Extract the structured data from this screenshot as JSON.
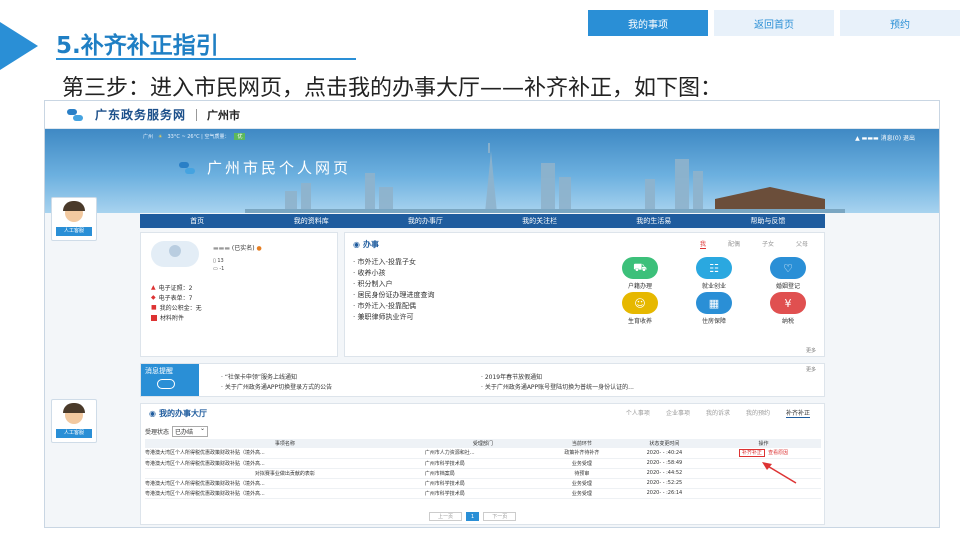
{
  "slide": {
    "section_title": "5.补齐补正指引",
    "step_text": "第三步：进入市民网页，点击我的办事大厅——补齐补正，如下图：",
    "top_tabs": [
      "我的事项",
      "返回首页",
      "预约"
    ],
    "accent_color": "#2a8fd6"
  },
  "site": {
    "portal_name": "广东政务服务网",
    "city": "广州市",
    "banner_city": "广州",
    "weather": "33°C ~ 26°C | 空气质量：",
    "aqi": "优",
    "banner_title": "广州市民个人网页",
    "user_links": "消息(0)  退出",
    "service_label": "人工客服"
  },
  "nav": [
    "首页",
    "我的资料库",
    "我的办事厅",
    "我的关注栏",
    "我的生活易",
    "帮助与反馈"
  ],
  "user_card": {
    "name": "(已实名)",
    "phone": "13",
    "line2": "-1",
    "stats": [
      "电子证照：2",
      "电子表单：7",
      "我的公积金：无",
      "材料附件"
    ]
  },
  "office": {
    "title": "办事",
    "tabs": [
      "我",
      "配偶",
      "子女",
      "父母"
    ],
    "items": [
      "市外迁入-投靠子女",
      "收养小孩",
      "积分制入户",
      "居民身份证办理进度查询",
      "市外迁入-投靠配偶",
      "兼职律师执业许可"
    ],
    "services": [
      {
        "label": "户籍办理",
        "icon": "car-icon",
        "color": "#3cc07a"
      },
      {
        "label": "就业创业",
        "icon": "people-icon",
        "color": "#2aa8e0"
      },
      {
        "label": "婚姻登记",
        "icon": "heart-icon",
        "color": "#2a8fd6"
      },
      {
        "label": "生育收养",
        "icon": "baby-icon",
        "color": "#e6b800"
      },
      {
        "label": "住房保障",
        "icon": "house-icon",
        "color": "#2a8fd6"
      },
      {
        "label": "纳税",
        "icon": "tax-icon",
        "color": "#e05050"
      }
    ],
    "more": "更多"
  },
  "messages": {
    "label": "消息提醒",
    "items": [
      "“社保卡申领”服务上线通知",
      "2019年春节放假通知",
      "关于广州政务通APP切换登录方式的公告",
      "关于广州政务通APP账号登陆切换为普统一身份认证的..."
    ],
    "more": "更多"
  },
  "hall": {
    "title": "我的办事大厅",
    "tabs": [
      "个人事项",
      "企业事项",
      "我的诉求",
      "我的预约",
      "补齐补正"
    ],
    "filter_label": "受理状态",
    "filter_value": "已办结",
    "columns": [
      "事项名称",
      "受理部门",
      "当前环节",
      "状态变更时间",
      "操作"
    ],
    "rows": [
      [
        "粤港澳大湾区个人所得税优惠政策财政补贴（境外高...",
        "广州市人力资源和社...",
        "政策补齐待补齐",
        "2020-  -  :40:24",
        "补齐补正",
        "查看原因"
      ],
      [
        "粤港澳大湾区个人所得税优惠政策财政补贴（境外高...",
        "广州市科学技术局",
        "业务受理",
        "2020-  -  :58:49",
        "",
        ""
      ],
      [
        "对拟赛事业做出贡献的表彰",
        "广州市档案局",
        "待预审",
        "2020-  -  :44:52",
        "",
        ""
      ],
      [
        "粤港澳大湾区个人所得税优惠政策财政补贴（境外高...",
        "广州市科学技术局",
        "业务受理",
        "2020-  -  :52:25",
        "",
        ""
      ],
      [
        "粤港澳大湾区个人所得税优惠政策财政补贴（境外高...",
        "广州市科学技术局",
        "业务受理",
        "2020-  -  :26:14",
        "",
        ""
      ]
    ],
    "pager": [
      "上一页",
      "1",
      "下一页"
    ]
  }
}
